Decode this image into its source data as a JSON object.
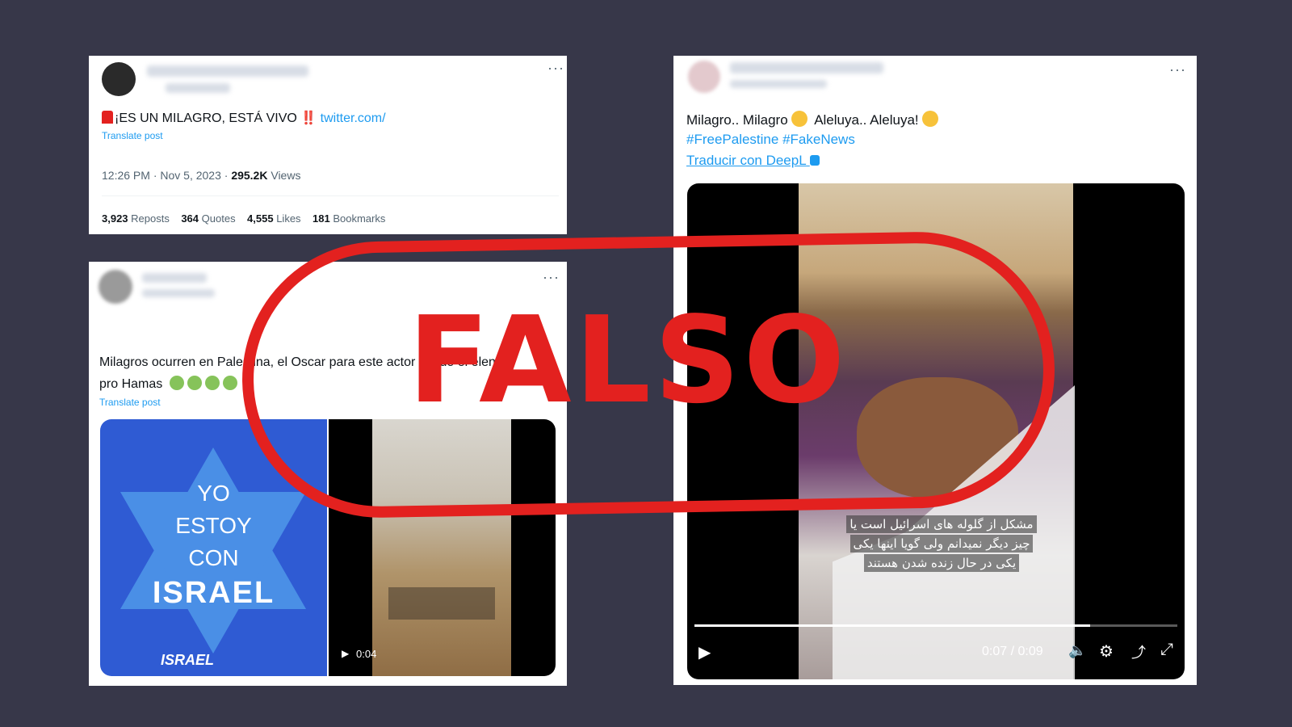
{
  "tweet1": {
    "text_main": "¡ES UN MILAGRO, ESTÁ VIVO",
    "exclaim": "‼️",
    "link": "twitter.com/",
    "translate": "Translate post",
    "time": "12:26 PM · Nov 5, 2023 · ",
    "views_count": "295.2K",
    "views_label": " Views",
    "stats": [
      {
        "n": "3,923",
        "l": "Reposts"
      },
      {
        "n": "364",
        "l": "Quotes"
      },
      {
        "n": "4,555",
        "l": "Likes"
      },
      {
        "n": "181",
        "l": "Bookmarks"
      }
    ]
  },
  "tweet2": {
    "line1": "Milagros ocurren en Palestina, el Oscar para este actor y todo el elenco",
    "line2": "pro Hamas",
    "translate": "Translate post",
    "israel_lines": [
      "YO",
      "ESTOY",
      "CON",
      "ISRAEL"
    ],
    "israel_logo": "ISRAEL",
    "video_time": "0:04"
  },
  "tweet3": {
    "line1": "Milagro.. Milagro",
    "line1b": "Aleluya.. Aleluya!",
    "hashtags": "#FreePalestine #FakeNews",
    "deepl": "Traducir con DeepL",
    "subtitle": [
      "مشکل از گلوله های اسرائیل است یا",
      "چیز دیگر نمیدانم ولی گویا اینها یکی",
      "یکی در حال زنده شدن هستند"
    ],
    "video_time": "0:07 / 0:09",
    "progress": 0.82
  },
  "stamp": "FALSO",
  "colors": {
    "stamp": "#e3211f",
    "link": "#1d9bf0",
    "background": "#373749"
  }
}
